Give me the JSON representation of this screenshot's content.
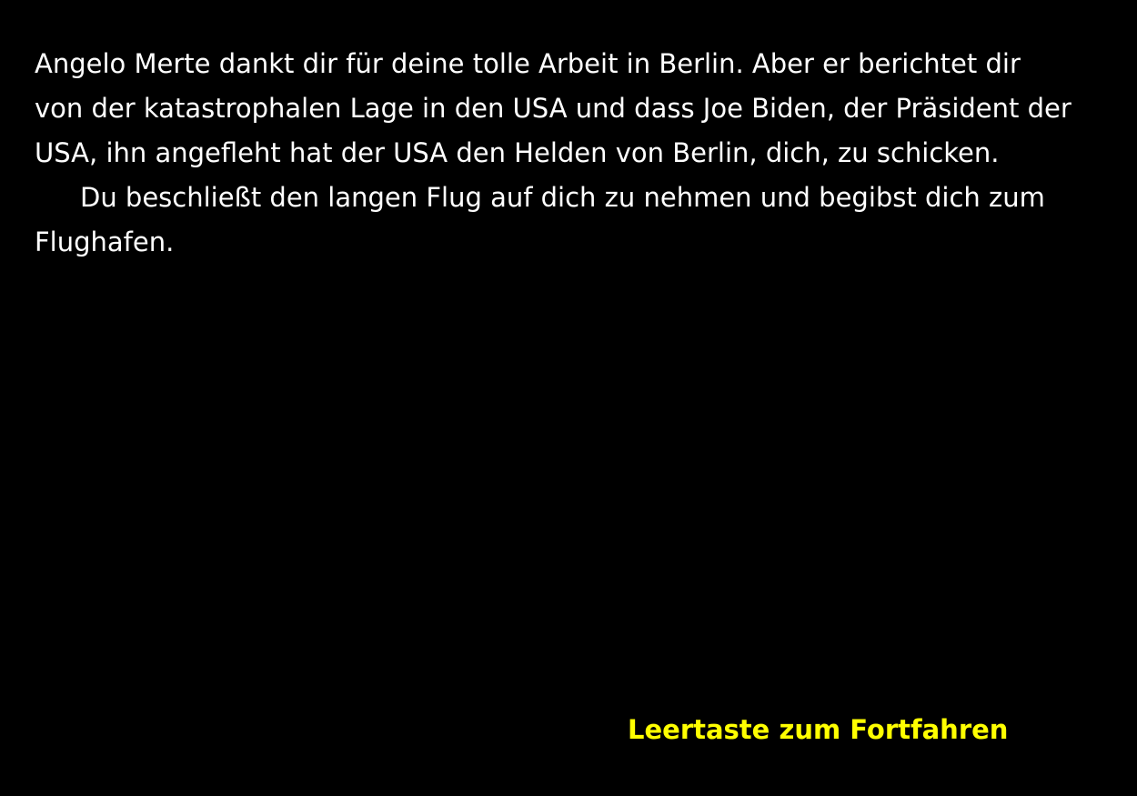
{
  "story": {
    "paragraph_1": "Angelo Merte dankt dir für deine tolle Arbeit in Berlin. Aber er berichtet dir von der katastrophalen Lage in den USA und dass Joe Biden, der Präsident der USA, ihn angefleht hat der USA den Helden von Berlin, dich, zu schicken.",
    "paragraph_2": "Du beschließt den langen Flug auf dich zu nehmen und begibst dich zum Flughafen."
  },
  "prompt": {
    "continue_label": "Leertaste zum Fortfahren"
  },
  "colors": {
    "background": "#000000",
    "story_text": "#ffffff",
    "prompt_text": "#ffff00"
  }
}
